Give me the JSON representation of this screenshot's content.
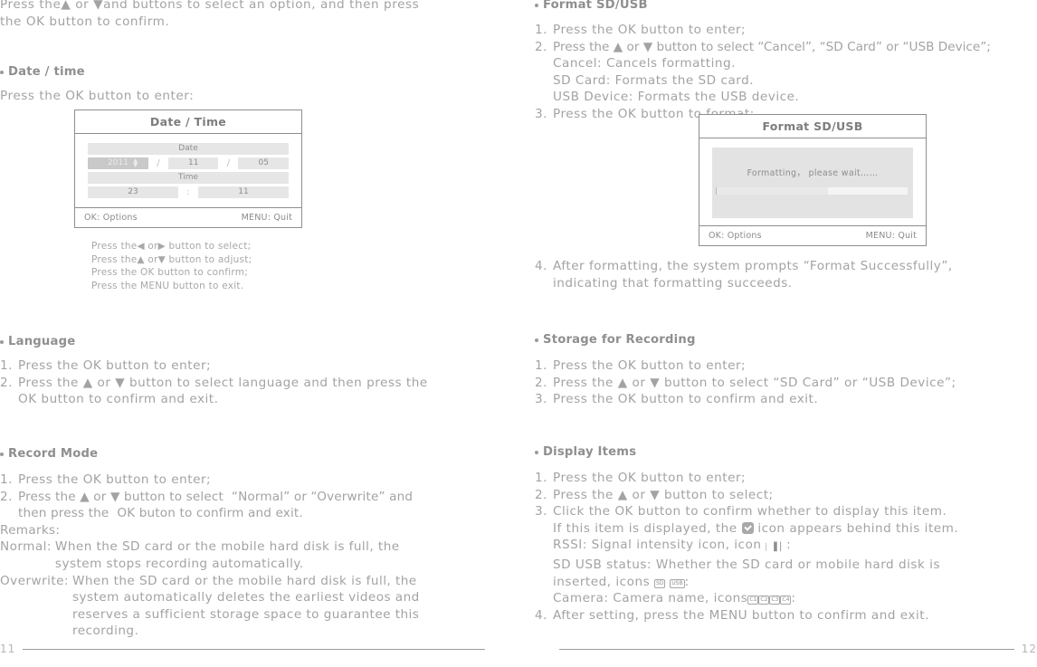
{
  "left_page": {
    "page_number": "11",
    "intro": "Press the▲ or ▼and buttons to select an option, and then press\nthe OK button to confirm.",
    "date_time_section": {
      "heading": "Date / time",
      "instruction": "Press the OK button to enter:",
      "panel": {
        "title": "Date / Time",
        "date_label": "Date",
        "time_label": "Time",
        "year": "2011",
        "month": "11",
        "day": "05",
        "hour": "23",
        "minute": "11",
        "date_separator": "/",
        "time_separator": ":",
        "footer_left": "OK: Options",
        "footer_right": "MENU: Quit"
      },
      "caption_lines": [
        "Press the◀ or▶ button to select;",
        "Press the▲ or▼ button to adjust;",
        "Press the OK button to confirm;",
        "Press the MENU button to exit."
      ]
    },
    "language_section": {
      "heading": "Language",
      "steps": [
        {
          "num": "1.",
          "text": "Press the OK button to enter;"
        },
        {
          "num": "2.",
          "text": "Press the ▲ or ▼ button to select language and then press the\nOK button to confirm and exit."
        }
      ]
    },
    "record_mode_section": {
      "heading": "Record Mode",
      "steps": [
        {
          "num": "1.",
          "text": "Press the OK button to enter;"
        },
        {
          "num": "2.",
          "text": "Press the ▲ or ▼ button to select  “Normal” or “Overwrite” and\nthen press the  OK buton to confirm and exit."
        }
      ],
      "remarks_label": "Remarks:",
      "remarks": [
        {
          "label": "Normal:",
          "text": "When the SD card or the mobile hard disk is full, the\nsystem stops recording automatically."
        },
        {
          "label": "Overwrite:",
          "text": "When the SD card or the mobile hard disk is full, the\nsystem automatically deletes the earliest videos and\nreserves a sufficient storage space to guarantee this\nrecording."
        }
      ]
    }
  },
  "right_page": {
    "page_number": "12",
    "format_section": {
      "heading": "Format SD/USB",
      "steps": [
        {
          "num": "1.",
          "text": "Press the OK button to enter;"
        },
        {
          "num": "2.",
          "text": "Press the ▲ or ▼ button to select “Cancel”, “SD Card” or “USB Device”;"
        }
      ],
      "sub_lines": [
        "Cancel: Cancels formatting.",
        "SD Card: Formats the SD card.",
        "USB Device: Formats the USB device."
      ],
      "step3": {
        "num": "3.",
        "text": "Press the OK button to format:"
      },
      "panel": {
        "title": "Format  SD/USB",
        "message": "Formatting， please  wait……",
        "progress_percent": 58,
        "footer_left": "OK: Options",
        "footer_right": "MENU: Quit"
      },
      "step4": {
        "num": "4.",
        "text": "After formatting, the system prompts “Format Successfully”,\nindicating that formatting succeeds."
      }
    },
    "storage_section": {
      "heading": "Storage for Recording",
      "steps": [
        {
          "num": "1.",
          "text": "Press the OK button to enter;"
        },
        {
          "num": "2.",
          "text": "Press the ▲ or ▼ button to select “SD Card” or “USB Device”;"
        },
        {
          "num": "3.",
          "text": "Press the OK button to confirm and exit."
        }
      ]
    },
    "display_items_section": {
      "heading": "Display Items",
      "steps": [
        {
          "num": "1.",
          "text": "Press the OK button to enter;"
        },
        {
          "num": "2.",
          "text": "Press the ▲ or ▼ button to select;"
        }
      ],
      "step3_num": "3.",
      "step3_line1": "Click the OK button to confirm whether to display this item.",
      "step3_line2a": "If this item is displayed, the",
      "step3_line2b": "icon appears behind this item.",
      "rssi_line_a": "RSSI: Signal intensity icon, icon",
      "rssi_line_b": ":",
      "sd_usb_line_a": "SD USB status: Whether the SD card or mobile hard disk is",
      "sd_usb_line_b": "inserted, icons",
      "sd_usb_line_c": ":",
      "camera_line_a": "Camera: Camera name, icons",
      "camera_line_b": ":",
      "icons": {
        "checkbox": "check-icon",
        "rssi": "signal-bars-icon",
        "sd": "SD",
        "usb": "USB",
        "cameras": [
          "C1",
          "C2",
          "C3",
          "C4"
        ]
      },
      "step4": {
        "num": "4.",
        "text": "After setting, press the MENU button to confirm and exit."
      }
    }
  },
  "colors": {
    "text": "#a3a3a3",
    "heading": "#8f8f8f",
    "panel_border": "#8e8e8e",
    "cell_bg": "#e6e6e6",
    "cell_selected": "#c9c9c9"
  }
}
